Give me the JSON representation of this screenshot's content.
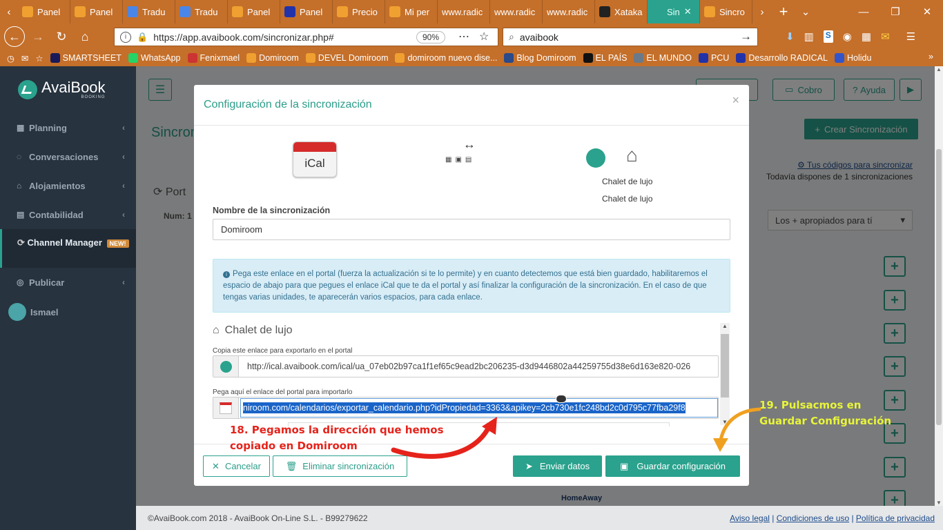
{
  "browser": {
    "tabs": [
      {
        "label": "Panel",
        "color": "#f0a030"
      },
      {
        "label": "Panel",
        "color": "#f0a030"
      },
      {
        "label": "Tradu",
        "color": "#4a86e8"
      },
      {
        "label": "Tradu",
        "color": "#4a86e8"
      },
      {
        "label": "Panel",
        "color": "#f0a030"
      },
      {
        "label": "Panel",
        "color": "#2233aa"
      },
      {
        "label": "Precio",
        "color": "#f0a030"
      },
      {
        "label": "Mi per",
        "color": "#f0a030"
      },
      {
        "label": "www.radic",
        "color": ""
      },
      {
        "label": "www.radic",
        "color": ""
      },
      {
        "label": "www.radic",
        "color": ""
      },
      {
        "label": "Xataka",
        "color": "#222222"
      },
      {
        "label": "Sin",
        "color": "#2aa28d"
      },
      {
        "label": "Sincro",
        "color": "#f0a030"
      }
    ],
    "more_tabs": "›",
    "new_tab": "+",
    "url": "https://app.avaibook.com/sincronizar.php#",
    "zoom": "90%",
    "search_value": "avaibook",
    "bookmarks": [
      "SMARTSHEET",
      "WhatsApp",
      "Fenixmael",
      "Domiroom",
      "DEVEL Domiroom",
      "domiroom nuevo dise...",
      "Blog Domiroom",
      "EL PAÍS",
      "EL MUNDO",
      "PCU",
      "Desarrollo RADICAL",
      "Holidu"
    ]
  },
  "sidebar": {
    "logo_text": "AvaiBook",
    "logo_sub": "BOOKING",
    "items": [
      "Planning",
      "Conversaciones",
      "Alojamientos",
      "Contabilidad"
    ],
    "channel_manager": "Channel Manager",
    "new_badge": "NEW!",
    "publicar": "Publicar",
    "user": "Ismael"
  },
  "page": {
    "title_partial": "Sincron",
    "cobro": "Cobro",
    "ayuda": "Ayuda",
    "crear": "Crear Sincronización",
    "codes_link": "Tus códigos para sincronizar",
    "remaining": "Todavía dispones de 1 sincronizaciones",
    "portales_partial": "Port",
    "num_partial": "Num: 1",
    "sort_select": "Los + apropiados para tí",
    "footer_copy": "©AvaiBook.com 2018 - AvaiBook On-Line S.L. - B99279622",
    "footer_links": [
      "Aviso legal",
      "Condiciones de uso",
      "Política de privacidad"
    ],
    "homeaway": "HomeAway"
  },
  "modal": {
    "title": "Configuración de la sincronización",
    "close": "×",
    "ical_label": "iCal",
    "arrows": "↔",
    "property_name": "Chalet de lujo",
    "property_name2": "Chalet de lujo",
    "name_label": "Nombre de la sincronización",
    "name_value": "Domiroom",
    "info_text": "Pega este enlace en el portal (fuerza la actualización si te lo permite) y en cuanto detectemos que está bien guardado, habilitaremos el espacio de abajo para que pegues el enlace iCal que te da el portal y así finalizar la configuración de la sincronización. En el caso de que tengas varias unidades, te aparecerán varios espacios, para cada enlace.",
    "unit_title": "Chalet de lujo",
    "export_label": "Copia este enlace para exportarlo en el portal",
    "export_url": "http://ical.avaibook.com/ical/ua_07eb02b97ca1f1ef65c9ead2bc206235-d3d9446802a44259755d38e6d163e820-026",
    "import_label": "Pega aquí el enlace del portal para importarlo",
    "import_url": "niroom.com/calendarios/exportar_calendario.php?idPropiedad=3363&apikey=2cb730e1fc248bd2c0d795c77fba29f8",
    "cancel": "Cancelar",
    "delete": "Eliminar sincronización",
    "send": "Enviar datos",
    "save": "Guardar configuración"
  },
  "annotations": {
    "step18_line1": "18. Pegamos la dirección que hemos",
    "step18_line2": "copiado en Domiroom",
    "step19_line1": "19. Pulsacmos en",
    "step19_line2": "Guardar Configuración",
    "step18_color": "#e5231b",
    "step19_color": "#e8f53a"
  },
  "colors": {
    "accent": "#2aa28d",
    "browser": "#c46f2a",
    "sidebar": "#27333f"
  }
}
